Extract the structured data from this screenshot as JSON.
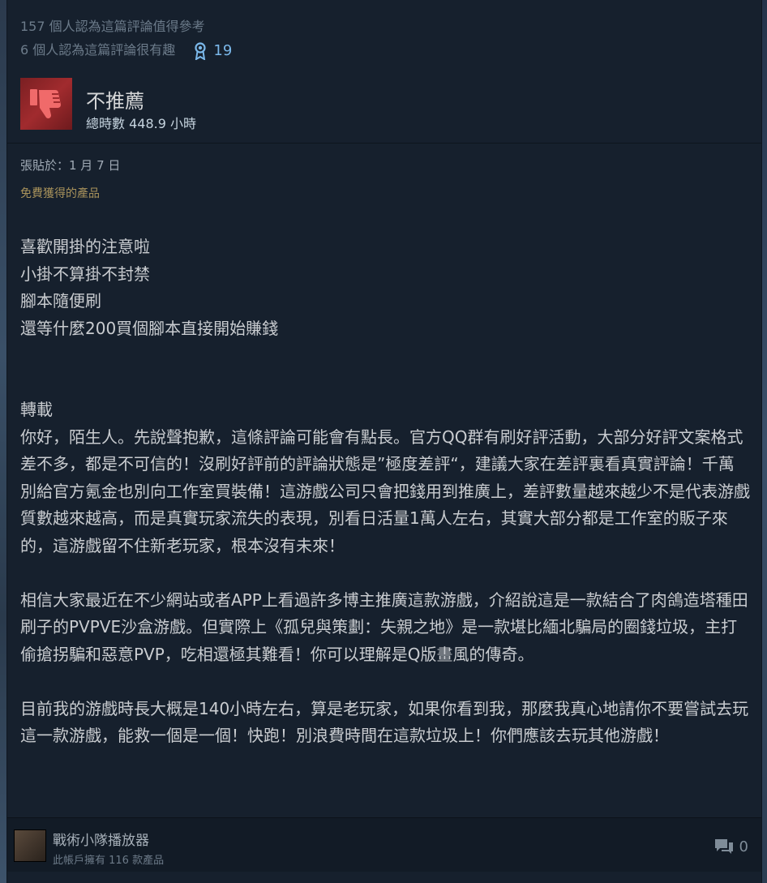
{
  "review": {
    "helpful_text": "157 個人認為這篇評論值得參考",
    "funny_text": "6 個人認為這篇評論很有趣",
    "award_count": "19",
    "verdict": "不推薦",
    "hours_label": "總時數 448.9 小時",
    "posted": "張貼於：1 月 7 日",
    "free_product": "免費獲得的產品",
    "paragraph_1": [
      "喜歡開掛的注意啦",
      "小掛不算掛不封禁",
      "腳本隨便刷",
      "還等什麼200買個腳本直接開始賺錢"
    ],
    "repost_label": "轉載",
    "paragraph_2": "你好，陌生人。先說聲抱歉，這條評論可能會有點長。官方QQ群有刷好評活動，大部分好評文案格式差不多，都是不可信的！沒刷好評前的評論狀態是”極度差評“，建議大家在差評裏看真實評論！千萬別給官方氪金也別向工作室買裝備！這游戲公司只會把錢用到推廣上，差評數量越來越少不是代表游戲質數越來越高，而是真實玩家流失的表現，別看日活量1萬人左右，其實大部分都是工作室的販子來的，這游戲留不住新老玩家，根本沒有未來！",
    "paragraph_3": "相信大家最近在不少網站或者APP上看過許多博主推廣這款游戲，介紹說這是一款結合了肉鴿造塔種田刷子的PVPVE沙盒游戲。但實際上《孤兒與策劃：失親之地》是一款堪比緬北騙局的圈錢垃圾，主打偷搶拐騙和惡意PVP，吃相還極其難看！你可以理解是Q版畫風的傳奇。",
    "paragraph_4": "目前我的游戲時長大概是140小時左右，算是老玩家，如果你看到我，那麼我真心地請你不要嘗試去玩這一款游戲，能救一個是一個！快跑！別浪費時間在這款垃圾上！你們應該去玩其他游戲！"
  },
  "author": {
    "name": "戰術小隊播放器",
    "products": "此帳戶擁有 116 款產品",
    "comment_count": "0"
  },
  "colors": {
    "thumb_bg": "#a12b2e",
    "award": "#7bb8ea",
    "free_product": "#a8925b"
  },
  "icons": {
    "verdict": "thumbs-down-icon",
    "award": "award-ribbon-icon",
    "comments": "speech-bubble-icon"
  }
}
